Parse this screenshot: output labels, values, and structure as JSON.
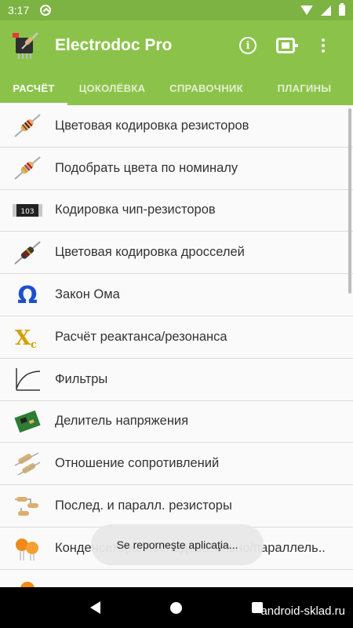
{
  "status_bar": {
    "time": "3:17"
  },
  "app_bar": {
    "title": "Electrodoc Pro"
  },
  "tabs": [
    {
      "label": "РАСЧЁТ",
      "active": true
    },
    {
      "label": "ЦОКОЛЁВКА",
      "active": false
    },
    {
      "label": "СПРАВОЧНИК",
      "active": false
    },
    {
      "label": "ПЛАГИНЫ",
      "active": false
    }
  ],
  "items": [
    {
      "label": "Цветовая кодировка резисторов",
      "icon": "resistor-icon"
    },
    {
      "label": "Подобрать цвета по номиналу",
      "icon": "resistor-icon"
    },
    {
      "label": "Кодировка чип-резисторов",
      "icon": "chip-resistor-icon"
    },
    {
      "label": "Цветовая кодировка дросселей",
      "icon": "inductor-icon"
    },
    {
      "label": "Закон Ома",
      "icon": "omega-icon"
    },
    {
      "label": "Расчёт реактанса/резонанса",
      "icon": "xc-icon"
    },
    {
      "label": "Фильтры",
      "icon": "filter-curve-icon"
    },
    {
      "label": "Делитель напряжения",
      "icon": "pcb-icon"
    },
    {
      "label": "Отношение сопротивлений",
      "icon": "resistors-pair-icon"
    },
    {
      "label": "Послед. и паралл. резисторы",
      "icon": "resistor-network-icon"
    },
    {
      "label": "Конденсаторы последовательно/параллель..",
      "icon": "capacitors-icon"
    },
    {
      "label": "",
      "icon": "capacitor-icon"
    }
  ],
  "toast": {
    "text": "Se reporneşte aplicaţia..."
  },
  "watermark": "android-sklad.ru",
  "colors": {
    "primary": "#8bc34a",
    "status_bar": "#7cb342"
  }
}
